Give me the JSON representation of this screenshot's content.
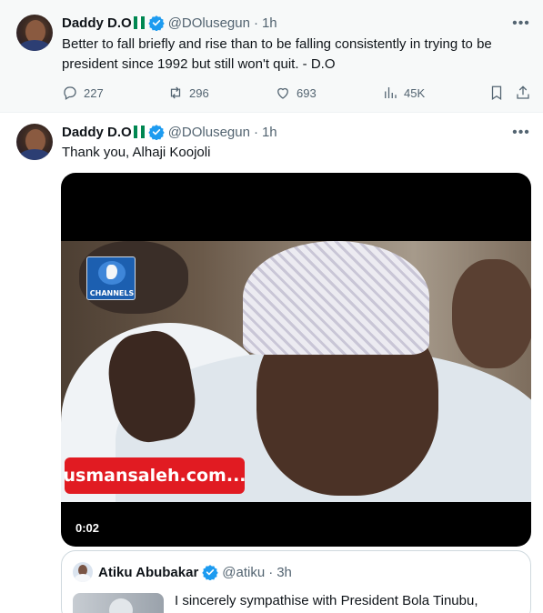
{
  "tweets": [
    {
      "author_name": "Daddy D.O",
      "handle": "@DOlusegun",
      "separator": "·",
      "time": "1h",
      "text": "Better to fall briefly and rise than to be falling consistently in trying to be president since 1992 but still won't quit. - D.O",
      "more_label": "•••",
      "stats": {
        "replies": "227",
        "reposts": "296",
        "likes": "693",
        "views": "45K"
      }
    },
    {
      "author_name": "Daddy D.O",
      "handle": "@DOlusegun",
      "separator": "·",
      "time": "1h",
      "text": "Thank you, Alhaji Koojoli",
      "more_label": "•••",
      "video": {
        "duration": "0:02",
        "channel_logo_text": "CHANNELS",
        "watermark": "usmansaleh.com..."
      },
      "quoted": {
        "author_name": "Atiku Abubakar",
        "handle": "@atiku",
        "separator": "·",
        "time": "3h",
        "text": "I sincerely sympathise with President Bola Tinubu,"
      }
    }
  ],
  "colors": {
    "verified_blue": "#1d9bf0",
    "flag_green": "#008751",
    "secondary_text": "#536471",
    "watermark_red": "#e11b22"
  },
  "icons": [
    "reply-icon",
    "repost-icon",
    "like-icon",
    "views-icon",
    "bookmark-icon",
    "share-icon",
    "verified-icon",
    "more-icon"
  ]
}
